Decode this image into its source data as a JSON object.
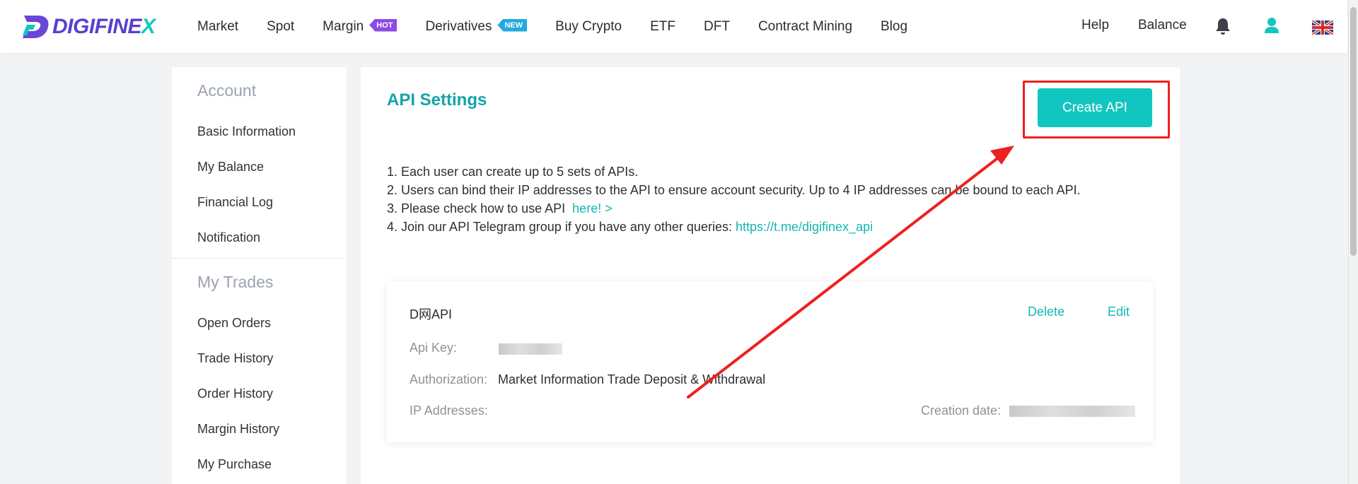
{
  "nav": {
    "logo_text": "DIGIFINEX",
    "items": [
      {
        "label": "Market"
      },
      {
        "label": "Spot"
      },
      {
        "label": "Margin",
        "badge": "HOT"
      },
      {
        "label": "Derivatives",
        "badge": "NEW"
      },
      {
        "label": "Buy Crypto"
      },
      {
        "label": "ETF"
      },
      {
        "label": "DFT"
      },
      {
        "label": "Contract Mining"
      },
      {
        "label": "Blog"
      }
    ],
    "help": "Help",
    "balance": "Balance",
    "icons": [
      "bell-icon",
      "user-icon",
      "uk-flag-icon"
    ]
  },
  "sidebar": {
    "account_heading": "Account",
    "account_items": [
      "Basic Information",
      "My Balance",
      "Financial Log",
      "Notification"
    ],
    "trades_heading": "My Trades",
    "trades_items": [
      "Open Orders",
      "Trade History",
      "Order History",
      "Margin History",
      "My Purchase"
    ]
  },
  "main": {
    "title": "API Settings",
    "create_button": "Create API",
    "notes": [
      "1. Each user can create up to 5 sets of APIs.",
      "2. Users can bind their IP addresses to the API to ensure account security. Up to 4 IP addresses can be bound to each API.",
      "3. Please check how to use API",
      "4. Join our API Telegram group if you have any other queries:"
    ],
    "here_link": "here! >",
    "telegram_link": "https://t.me/digifinex_api",
    "card": {
      "name": "D网API",
      "delete": "Delete",
      "edit": "Edit",
      "api_key_label": "Api Key:",
      "authorization_label": "Authorization:",
      "authorization_value": "Market Information Trade Deposit & Withdrawal",
      "ip_label": "IP Addresses:",
      "creation_label": "Creation date:"
    }
  },
  "colors": {
    "accent": "#11c6c0",
    "brand_purple": "#5b3fd0",
    "annotation_red": "#ee1f1f"
  }
}
